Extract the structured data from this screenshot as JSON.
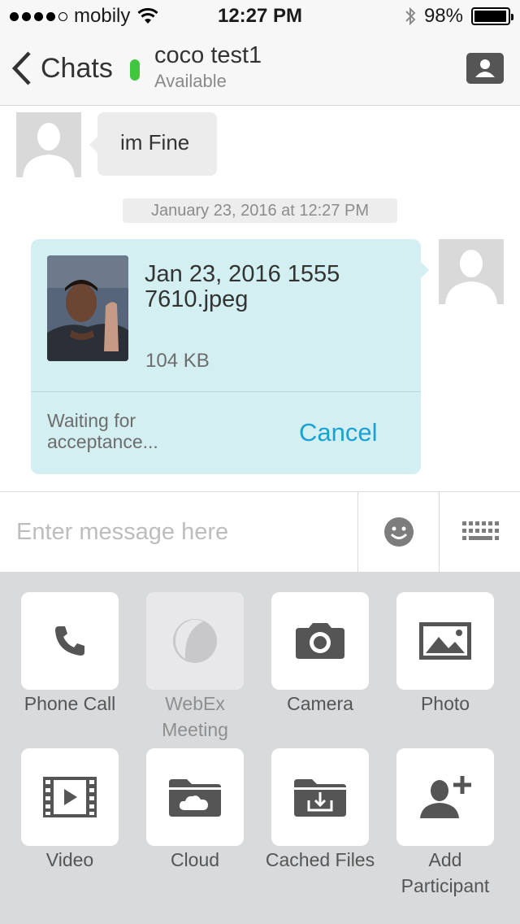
{
  "status_bar": {
    "carrier": "mobily",
    "time": "12:27 PM",
    "battery": "98%",
    "battery_level": 0.98
  },
  "nav": {
    "back_label": "Chats",
    "contact_name": "coco test1",
    "contact_status": "Available",
    "presence_color": "#41c63f"
  },
  "messages": {
    "incoming_text": "im Fine",
    "timestamp": "January 23, 2016 at 12:27 PM",
    "file": {
      "name": "Jan 23, 2016 1555 7610.jpeg",
      "size": "104 KB",
      "status": "Waiting for acceptance...",
      "cancel_label": "Cancel"
    }
  },
  "input": {
    "placeholder": "Enter message here"
  },
  "actions": [
    {
      "label": "Phone Call",
      "icon": "phone-icon",
      "enabled": true
    },
    {
      "label": "WebEx Meeting",
      "icon": "webex-icon",
      "enabled": false
    },
    {
      "label": "Camera",
      "icon": "camera-icon",
      "enabled": true
    },
    {
      "label": "Photo",
      "icon": "photo-icon",
      "enabled": true
    },
    {
      "label": "Video",
      "icon": "video-icon",
      "enabled": true
    },
    {
      "label": "Cloud",
      "icon": "cloud-folder-icon",
      "enabled": true
    },
    {
      "label": "Cached Files",
      "icon": "cached-files-icon",
      "enabled": true
    },
    {
      "label": "Add Participant",
      "icon": "add-participant-icon",
      "enabled": true
    }
  ],
  "colors": {
    "accent": "#1ba1d3",
    "file_bubble": "#d3eff2",
    "panel_bg": "#d8dadc"
  }
}
